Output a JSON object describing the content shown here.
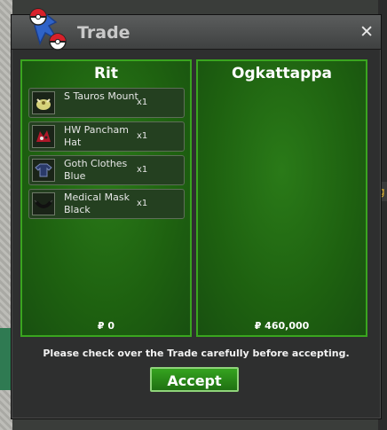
{
  "window": {
    "title": "Trade",
    "close_label": "✕"
  },
  "left": {
    "name": "Rit",
    "money": "₽ 0",
    "items": [
      {
        "name": "S Tauros Mount",
        "qty": "x1",
        "icon": "tauros-mount-icon"
      },
      {
        "name": "HW Pancham Hat",
        "qty": "x1",
        "icon": "pancham-hat-icon"
      },
      {
        "name": "Goth Clothes Blue",
        "qty": "x1",
        "icon": "goth-clothes-icon"
      },
      {
        "name": "Medical Mask Black",
        "qty": "x1",
        "icon": "medical-mask-icon"
      }
    ]
  },
  "right": {
    "name": "Ogkattappa",
    "money": "₽ 460,000",
    "items": []
  },
  "notice": "Please check over the Trade carefully before accepting.",
  "accept_label": "Accept",
  "colors": {
    "panel_green": "#1e6110",
    "panel_border": "#3aa51f",
    "button_green": "#2a8a18"
  }
}
